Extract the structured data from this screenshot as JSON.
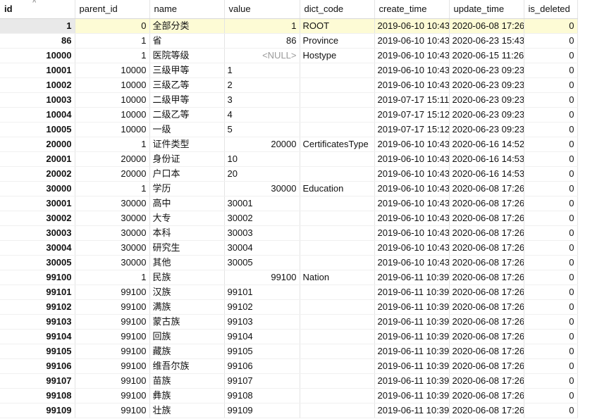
{
  "columns": [
    "id",
    "parent_id",
    "name",
    "value",
    "dict_code",
    "create_time",
    "update_time",
    "is_deleted"
  ],
  "rows": [
    {
      "id": "1",
      "parent_id": "0",
      "name": "全部分类",
      "value": "1",
      "dict_code": "ROOT",
      "create_time": "2019-06-10 10:43",
      "update_time": "2020-06-08 17:26",
      "is_deleted": "0"
    },
    {
      "id": "86",
      "parent_id": "1",
      "name": "省",
      "value": "86",
      "dict_code": "Province",
      "create_time": "2019-06-10 10:43",
      "update_time": "2020-06-23 15:43",
      "is_deleted": "0"
    },
    {
      "id": "10000",
      "parent_id": "1",
      "name": "医院等级",
      "value": "<NULL>",
      "dict_code": "Hostype",
      "create_time": "2019-06-10 10:43",
      "update_time": "2020-06-15 11:26",
      "is_deleted": "0"
    },
    {
      "id": "10001",
      "parent_id": "10000",
      "name": "三级甲等",
      "value": "1",
      "dict_code": "",
      "create_time": "2019-06-10 10:43",
      "update_time": "2020-06-23 09:23",
      "is_deleted": "0"
    },
    {
      "id": "10002",
      "parent_id": "10000",
      "name": "三级乙等",
      "value": "2",
      "dict_code": "",
      "create_time": "2019-06-10 10:43",
      "update_time": "2020-06-23 09:23",
      "is_deleted": "0"
    },
    {
      "id": "10003",
      "parent_id": "10000",
      "name": "二级甲等",
      "value": "3",
      "dict_code": "",
      "create_time": "2019-07-17 15:11",
      "update_time": "2020-06-23 09:23",
      "is_deleted": "0"
    },
    {
      "id": "10004",
      "parent_id": "10000",
      "name": "二级乙等",
      "value": "4",
      "dict_code": "",
      "create_time": "2019-07-17 15:12",
      "update_time": "2020-06-23 09:23",
      "is_deleted": "0"
    },
    {
      "id": "10005",
      "parent_id": "10000",
      "name": "一级",
      "value": "5",
      "dict_code": "",
      "create_time": "2019-07-17 15:12",
      "update_time": "2020-06-23 09:23",
      "is_deleted": "0"
    },
    {
      "id": "20000",
      "parent_id": "1",
      "name": "证件类型",
      "value": "20000",
      "dict_code": "CertificatesType",
      "create_time": "2019-06-10 10:43",
      "update_time": "2020-06-16 14:52",
      "is_deleted": "0"
    },
    {
      "id": "20001",
      "parent_id": "20000",
      "name": "身份证",
      "value": "10",
      "dict_code": "",
      "create_time": "2019-06-10 10:43",
      "update_time": "2020-06-16 14:53",
      "is_deleted": "0"
    },
    {
      "id": "20002",
      "parent_id": "20000",
      "name": "户口本",
      "value": "20",
      "dict_code": "",
      "create_time": "2019-06-10 10:43",
      "update_time": "2020-06-16 14:53",
      "is_deleted": "0"
    },
    {
      "id": "30000",
      "parent_id": "1",
      "name": "学历",
      "value": "30000",
      "dict_code": "Education",
      "create_time": "2019-06-10 10:43",
      "update_time": "2020-06-08 17:26",
      "is_deleted": "0"
    },
    {
      "id": "30001",
      "parent_id": "30000",
      "name": "高中",
      "value": "30001",
      "dict_code": "",
      "create_time": "2019-06-10 10:43",
      "update_time": "2020-06-08 17:26",
      "is_deleted": "0"
    },
    {
      "id": "30002",
      "parent_id": "30000",
      "name": "大专",
      "value": "30002",
      "dict_code": "",
      "create_time": "2019-06-10 10:43",
      "update_time": "2020-06-08 17:26",
      "is_deleted": "0"
    },
    {
      "id": "30003",
      "parent_id": "30000",
      "name": "本科",
      "value": "30003",
      "dict_code": "",
      "create_time": "2019-06-10 10:43",
      "update_time": "2020-06-08 17:26",
      "is_deleted": "0"
    },
    {
      "id": "30004",
      "parent_id": "30000",
      "name": "研究生",
      "value": "30004",
      "dict_code": "",
      "create_time": "2019-06-10 10:43",
      "update_time": "2020-06-08 17:26",
      "is_deleted": "0"
    },
    {
      "id": "30005",
      "parent_id": "30000",
      "name": "其他",
      "value": "30005",
      "dict_code": "",
      "create_time": "2019-06-10 10:43",
      "update_time": "2020-06-08 17:26",
      "is_deleted": "0"
    },
    {
      "id": "99100",
      "parent_id": "1",
      "name": "民族",
      "value": "99100",
      "dict_code": "Nation",
      "create_time": "2019-06-11 10:39",
      "update_time": "2020-06-08 17:26",
      "is_deleted": "0"
    },
    {
      "id": "99101",
      "parent_id": "99100",
      "name": "汉族",
      "value": "99101",
      "dict_code": "",
      "create_time": "2019-06-11 10:39",
      "update_time": "2020-06-08 17:26",
      "is_deleted": "0"
    },
    {
      "id": "99102",
      "parent_id": "99100",
      "name": "满族",
      "value": "99102",
      "dict_code": "",
      "create_time": "2019-06-11 10:39",
      "update_time": "2020-06-08 17:26",
      "is_deleted": "0"
    },
    {
      "id": "99103",
      "parent_id": "99100",
      "name": "蒙古族",
      "value": "99103",
      "dict_code": "",
      "create_time": "2019-06-11 10:39",
      "update_time": "2020-06-08 17:26",
      "is_deleted": "0"
    },
    {
      "id": "99104",
      "parent_id": "99100",
      "name": "回族",
      "value": "99104",
      "dict_code": "",
      "create_time": "2019-06-11 10:39",
      "update_time": "2020-06-08 17:26",
      "is_deleted": "0"
    },
    {
      "id": "99105",
      "parent_id": "99100",
      "name": "藏族",
      "value": "99105",
      "dict_code": "",
      "create_time": "2019-06-11 10:39",
      "update_time": "2020-06-08 17:26",
      "is_deleted": "0"
    },
    {
      "id": "99106",
      "parent_id": "99100",
      "name": "维吾尔族",
      "value": "99106",
      "dict_code": "",
      "create_time": "2019-06-11 10:39",
      "update_time": "2020-06-08 17:26",
      "is_deleted": "0"
    },
    {
      "id": "99107",
      "parent_id": "99100",
      "name": "苗族",
      "value": "99107",
      "dict_code": "",
      "create_time": "2019-06-11 10:39",
      "update_time": "2020-06-08 17:26",
      "is_deleted": "0"
    },
    {
      "id": "99108",
      "parent_id": "99100",
      "name": "彝族",
      "value": "99108",
      "dict_code": "",
      "create_time": "2019-06-11 10:39",
      "update_time": "2020-06-08 17:26",
      "is_deleted": "0"
    },
    {
      "id": "99109",
      "parent_id": "99100",
      "name": "壮族",
      "value": "99109",
      "dict_code": "",
      "create_time": "2019-06-11 10:39",
      "update_time": "2020-06-08 17:26",
      "is_deleted": "0"
    }
  ],
  "sort_icon": "sort-ascending-icon",
  "colors": {
    "selected_row": "#fdfbd5",
    "null_text": "#9a9a9a"
  }
}
